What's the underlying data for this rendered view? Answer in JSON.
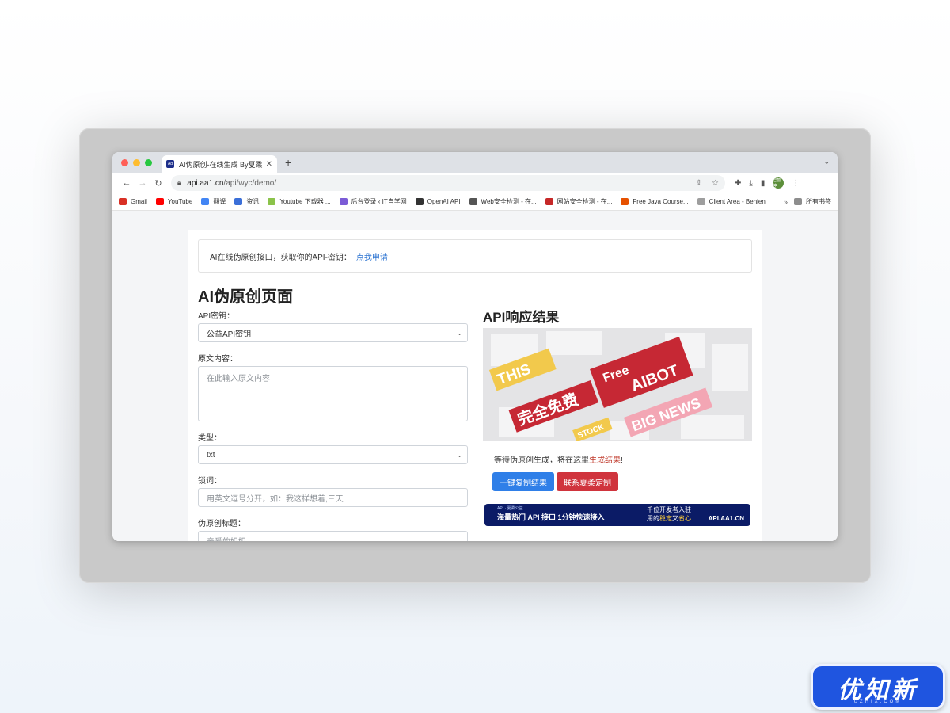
{
  "browser": {
    "tab_title": "AI伪原创-在线生成 By夏柔公益",
    "tab_favicon": "Ad",
    "url_host": "api.aa1.cn",
    "url_path": "/api/wyc/demo/",
    "avatar_text": "已暂停"
  },
  "bookmarks": [
    {
      "label": "Gmail",
      "icon": "gmail-icon",
      "color": "#d93025"
    },
    {
      "label": "YouTube",
      "icon": "youtube-icon",
      "color": "#ff0000"
    },
    {
      "label": "翻译",
      "icon": "translate-icon",
      "color": "#4285f4"
    },
    {
      "label": "资讯",
      "icon": "news-icon",
      "color": "#3b6fd8"
    },
    {
      "label": "Youtube 下载器 ...",
      "icon": "download-icon",
      "color": "#8bc34a"
    },
    {
      "label": "后台登录 ‹ IT自学网",
      "icon": "gem-icon",
      "color": "#7b5bd6"
    },
    {
      "label": "OpenAI API",
      "icon": "openai-icon",
      "color": "#333333"
    },
    {
      "label": "Web安全检测 - 在...",
      "icon": "globe-icon",
      "color": "#555555"
    },
    {
      "label": "网站安全检测 - 在...",
      "icon": "shield-icon",
      "color": "#c62828"
    },
    {
      "label": "Free Java Course...",
      "icon": "java-icon",
      "color": "#e65100"
    },
    {
      "label": "Client Area - Benien",
      "icon": "circle-icon",
      "color": "#9e9e9e"
    }
  ],
  "bookmarks_more": "»",
  "bookmarks_folder": "所有书签",
  "page": {
    "notice_text": "AI在线伪原创接口，获取你的API-密钥：",
    "notice_link": "点我申请",
    "left_heading": "AI伪原创页面",
    "right_heading": "API响应结果",
    "api_key_label": "API密钥：",
    "api_key_value": "公益API密钥",
    "content_label": "原文内容：",
    "content_placeholder": "在此输入原文内容",
    "type_label": "类型：",
    "type_value": "txt",
    "lock_label": "锁词：",
    "lock_placeholder": "用英文逗号分开，如：我这样想着,三天",
    "title_label": "伪原创标题：",
    "title_placeholder": "亲爱的姐姐",
    "result_prefix": "等待伪原创生成，将在这里",
    "result_highlight": "生成结果",
    "result_suffix": "!",
    "copy_button": "一键复制结果",
    "contact_button": "联系夏柔定制"
  },
  "banner": {
    "this_week": "THIS WEEK",
    "free": "Free",
    "aibot": "AIBOT",
    "free_cn": "完全免费",
    "big_news": "BIG NEWS",
    "stock": "STOCK"
  },
  "ad": {
    "brand": "API · 夏柔公益",
    "main": "海量热门 API 接口 1分钟快速接入",
    "mid1": "千位开发者入驻",
    "mid2a": "用的",
    "mid2b": "稳定",
    "mid2c": "又",
    "mid2d": "省心",
    "url": "API.AA1.CN"
  },
  "logo": {
    "main": "优知新",
    "sub": "UZHIX.COM"
  }
}
